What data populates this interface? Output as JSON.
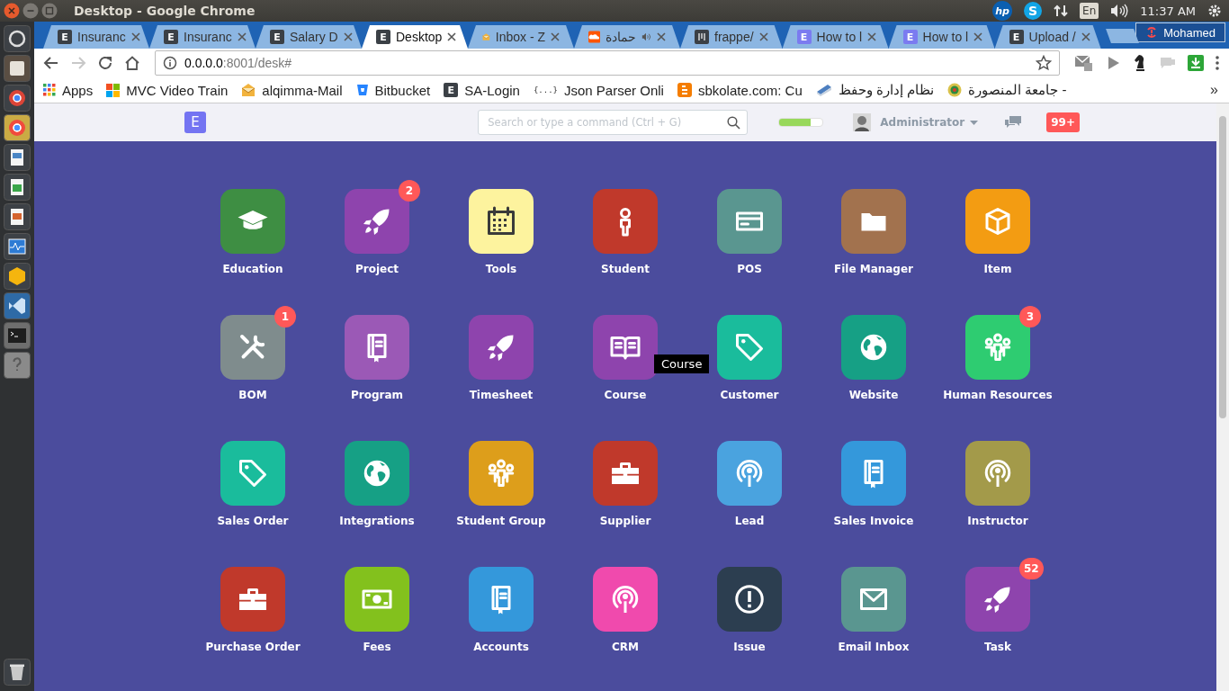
{
  "window": {
    "title": "Desktop - Google Chrome"
  },
  "top_panel": {
    "hp_logo": "hp",
    "skype_logo": "S",
    "keyboard": "En",
    "time": "11:37 AM"
  },
  "tabs": [
    {
      "title": "Insuranc",
      "selected": false,
      "favicon": {
        "kind": "letter",
        "letter": "E",
        "color": "#3b4046"
      }
    },
    {
      "title": "Insuranc",
      "selected": false,
      "favicon": {
        "kind": "letter",
        "letter": "E",
        "color": "#3b4046"
      }
    },
    {
      "title": "Salary D",
      "selected": false,
      "favicon": {
        "kind": "letter",
        "letter": "E",
        "color": "#3b4046"
      }
    },
    {
      "title": "Desktop",
      "selected": true,
      "favicon": {
        "kind": "letter",
        "letter": "E",
        "color": "#3b4046"
      }
    },
    {
      "title": "Inbox - Z",
      "selected": false,
      "favicon": {
        "kind": "mail"
      }
    },
    {
      "title": "حمادة",
      "selected": false,
      "audible": true,
      "favicon": {
        "kind": "cloud"
      }
    },
    {
      "title": "frappe/",
      "selected": false,
      "favicon": {
        "kind": "bars"
      }
    },
    {
      "title": "How to l",
      "selected": false,
      "favicon": {
        "kind": "letter",
        "letter": "E",
        "color": "#7b7bf0"
      }
    },
    {
      "title": "How to l",
      "selected": false,
      "favicon": {
        "kind": "letter",
        "letter": "E",
        "color": "#7b7bf0"
      }
    },
    {
      "title": "Upload /",
      "selected": false,
      "favicon": {
        "kind": "letter",
        "letter": "E",
        "color": "#3b4046"
      }
    }
  ],
  "profile": {
    "name": "Mohamed"
  },
  "toolbar": {
    "forward_disabled": true,
    "host": "0.0.0.0",
    "path": ":8001/desk#"
  },
  "bookmarks": [
    {
      "label": "Apps",
      "kind": "apps"
    },
    {
      "label": "MVC Video Train",
      "kind": "squares"
    },
    {
      "label": "alqimma-Mail",
      "kind": "mail"
    },
    {
      "label": "Bitbucket",
      "kind": "shield"
    },
    {
      "label": "SA-Login",
      "kind": "letter",
      "letter": "E"
    },
    {
      "label": "Json Parser Onli",
      "kind": "text",
      "text": "{...}"
    },
    {
      "label": "sbkolate.com: Cu",
      "kind": "blog"
    },
    {
      "label": "نظام إدارة وحفظ",
      "kind": "scanner"
    },
    {
      "label": "جامعة المنصورة -",
      "kind": "emblem"
    }
  ],
  "bookmarks_more": "»",
  "navbar": {
    "logo": "E",
    "search_placeholder": "Search or type a command (Ctrl + G)",
    "progress": {
      "level": 0.72
    },
    "user": "Administrator",
    "notifications": "99+"
  },
  "modules": [
    {
      "label": "Education",
      "color": "#3e8e43",
      "kind": "cap"
    },
    {
      "label": "Project",
      "color": "#8e44ad",
      "kind": "rocket",
      "badge": "2"
    },
    {
      "label": "Tools",
      "color": "#fdf39e",
      "kind": "calendar"
    },
    {
      "label": "Student",
      "color": "#c0392b",
      "kind": "person"
    },
    {
      "label": "POS",
      "color": "#5a9690",
      "kind": "card"
    },
    {
      "label": "File Manager",
      "color": "#a2724e",
      "kind": "folder"
    },
    {
      "label": "Item",
      "color": "#f39c12",
      "kind": "box"
    },
    {
      "label": "BOM",
      "color": "#7f8c8d",
      "kind": "tools",
      "badge": "1"
    },
    {
      "label": "Program",
      "color": "#9b59b6",
      "kind": "book"
    },
    {
      "label": "Timesheet",
      "color": "#8e44ad",
      "kind": "rocket"
    },
    {
      "label": "Course",
      "color": "#8e44ad",
      "kind": "bookopen",
      "tooltip": "Course"
    },
    {
      "label": "Customer",
      "color": "#1abc9c",
      "kind": "tag"
    },
    {
      "label": "Website",
      "color": "#16a085",
      "kind": "globe"
    },
    {
      "label": "Human Resources",
      "color": "#2ecc71",
      "kind": "people",
      "badge": "3"
    },
    {
      "label": "Sales Order",
      "color": "#1abc9c",
      "kind": "tag"
    },
    {
      "label": "Integrations",
      "color": "#16a085",
      "kind": "globe"
    },
    {
      "label": "Student Group",
      "color": "#dd9e1b",
      "kind": "people"
    },
    {
      "label": "Supplier",
      "color": "#c0392b",
      "kind": "briefcase"
    },
    {
      "label": "Lead",
      "color": "#4aa3df",
      "kind": "podcast"
    },
    {
      "label": "Sales Invoice",
      "color": "#3498db",
      "kind": "book"
    },
    {
      "label": "Instructor",
      "color": "#a39a4a",
      "kind": "podcast"
    },
    {
      "label": "Purchase Order",
      "color": "#c0392b",
      "kind": "briefcase"
    },
    {
      "label": "Fees",
      "color": "#83c11d",
      "kind": "money"
    },
    {
      "label": "Accounts",
      "color": "#3498db",
      "kind": "book"
    },
    {
      "label": "CRM",
      "color": "#f04aad",
      "kind": "podcast"
    },
    {
      "label": "Issue",
      "color": "#2c3e50",
      "kind": "exclaim"
    },
    {
      "label": "Email Inbox",
      "color": "#5a9690",
      "kind": "envelope"
    },
    {
      "label": "Task",
      "color": "#8e44ad",
      "kind": "rocket",
      "badge": "52"
    }
  ]
}
